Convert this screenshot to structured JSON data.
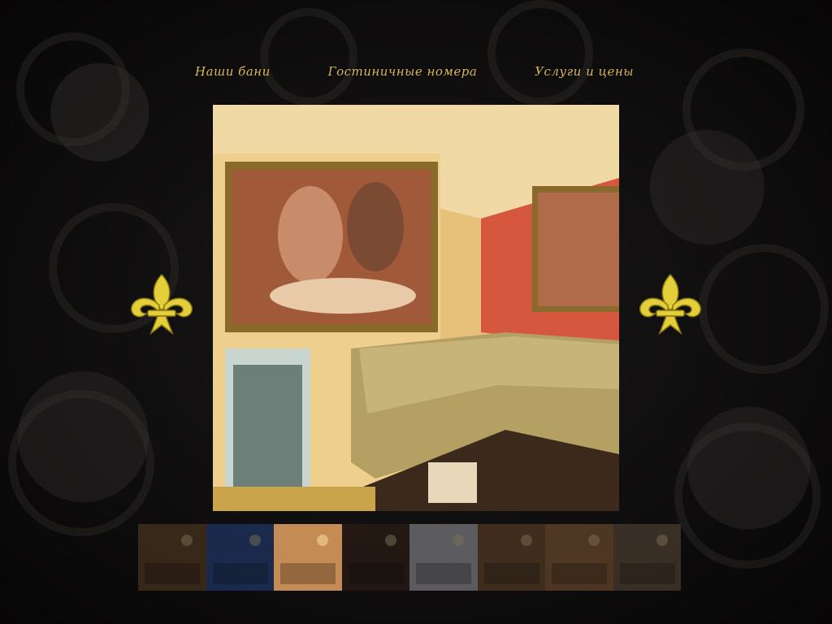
{
  "nav": {
    "items": [
      {
        "label": "Наши бани"
      },
      {
        "label": "Гостиничные номера"
      },
      {
        "label": "Услуги и цены"
      }
    ]
  },
  "gallery": {
    "main_photo_icon": "sauna-room-photo",
    "prev_icon": "fleur-de-lis-icon",
    "next_icon": "fleur-de-lis-icon",
    "active_index": 2,
    "thumbnails": [
      {
        "icon": "brown-lounge-photo",
        "color": "#6b4a2a"
      },
      {
        "icon": "blue-room-photo",
        "color": "#2b4f9a"
      },
      {
        "icon": "sofa-room-photo",
        "color": "#c48b55"
      },
      {
        "icon": "dark-bar-photo",
        "color": "#3a2418"
      },
      {
        "icon": "white-pool-photo",
        "color": "#b9b9c2"
      },
      {
        "icon": "dining-hall-photo",
        "color": "#7a5330"
      },
      {
        "icon": "golden-hall-photo",
        "color": "#9c6a3c"
      },
      {
        "icon": "banquet-photo",
        "color": "#6e5a45"
      }
    ]
  },
  "colors": {
    "gold": "#d8b85a",
    "background": "#0b0a0a"
  }
}
